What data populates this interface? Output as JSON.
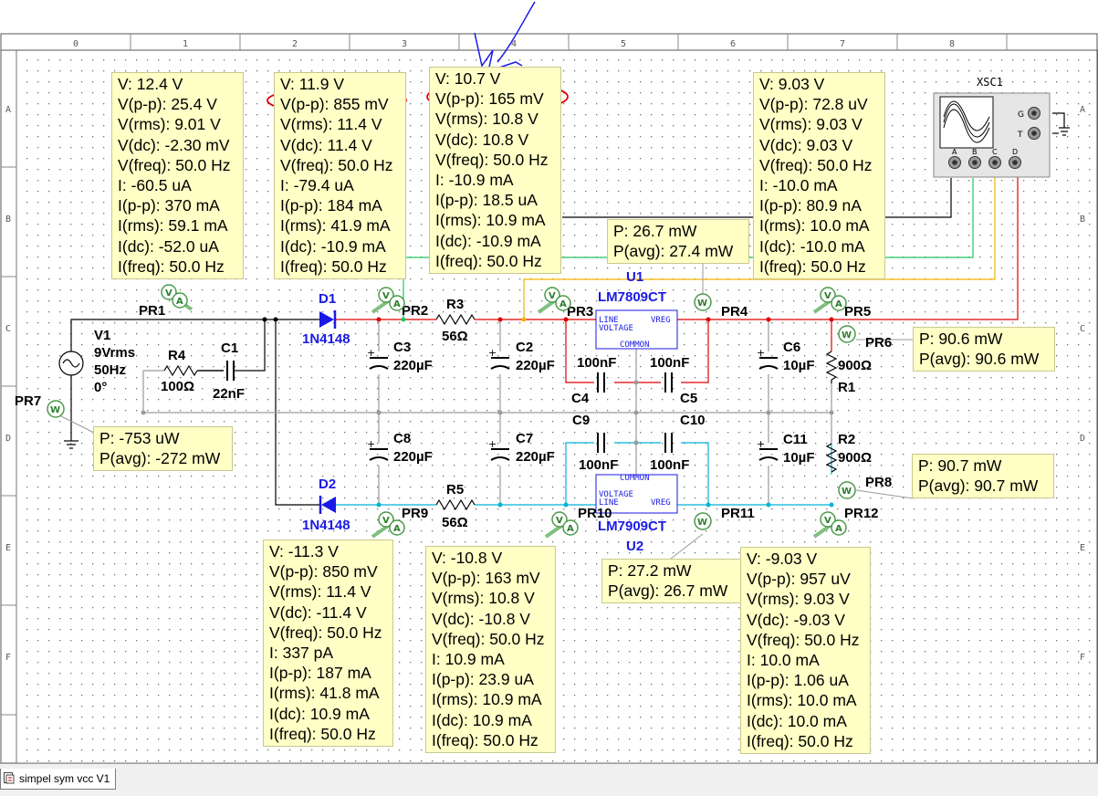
{
  "ruler": {
    "columns": [
      "0",
      "1",
      "2",
      "3",
      "4",
      "5",
      "6",
      "7",
      "8"
    ],
    "rows": [
      "A",
      "B",
      "C",
      "D",
      "E",
      "F"
    ]
  },
  "components": {
    "v1": {
      "name": "V1",
      "line1": "9Vrms",
      "line2": "50Hz",
      "line3": "0°"
    },
    "r4": {
      "name": "R4",
      "value": "100Ω"
    },
    "c1": {
      "name": "C1",
      "value": "22nF"
    },
    "d1": {
      "name": "D1",
      "model": "1N4148"
    },
    "d2": {
      "name": "D2",
      "model": "1N4148"
    },
    "r3": {
      "name": "R3",
      "value": "56Ω"
    },
    "r5": {
      "name": "R5",
      "value": "56Ω"
    },
    "c3": {
      "name": "C3",
      "value": "220µF"
    },
    "c2": {
      "name": "C2",
      "value": "220µF"
    },
    "c8": {
      "name": "C8",
      "value": "220µF"
    },
    "c7": {
      "name": "C7",
      "value": "220µF"
    },
    "c4": {
      "name": "C4",
      "value": "100nF"
    },
    "c5": {
      "name": "C5",
      "value": "100nF"
    },
    "c9": {
      "name": "C9",
      "value": "100nF"
    },
    "c10": {
      "name": "C10",
      "value": "100nF"
    },
    "c6": {
      "name": "C6",
      "value": "10µF"
    },
    "c11": {
      "name": "C11",
      "value": "10µF"
    },
    "r1": {
      "name": "R1",
      "value": "900Ω"
    },
    "r2": {
      "name": "R2",
      "value": "900Ω"
    },
    "u1": {
      "name": "U1",
      "model": "LM7809CT",
      "pin_line": "LINE",
      "pin_vreg": "VREG",
      "pin_voltage": "VOLTAGE",
      "pin_common": "COMMON"
    },
    "u2": {
      "name": "U2",
      "model": "LM7909CT",
      "pin_line": "LINE",
      "pin_vreg": "VREG",
      "pin_voltage": "VOLTAGE",
      "pin_common": "COMMON"
    },
    "xsc1": {
      "name": "XSC1",
      "ch_a": "A",
      "ch_b": "B",
      "ch_c": "C",
      "ch_d": "D",
      "gnd": "G",
      "trig": "T"
    }
  },
  "probes": {
    "pr1": "PR1",
    "pr2": "PR2",
    "pr3": "PR3",
    "pr4": "PR4",
    "pr5": "PR5",
    "pr6": "PR6",
    "pr7": "PR7",
    "pr8": "PR8",
    "pr9": "PR9",
    "pr10": "PR10",
    "pr11": "PR11",
    "pr12": "PR12"
  },
  "probe_glyph": {
    "volt": "V",
    "amp": "A",
    "watt": "W"
  },
  "meters": {
    "pr1": [
      "V: 12.4 V",
      "V(p-p): 25.4 V",
      "V(rms): 9.01 V",
      "V(dc): -2.30 mV",
      "V(freq): 50.0 Hz",
      "I: -60.5 uA",
      "I(p-p): 370 mA",
      "I(rms): 59.1 mA",
      "I(dc): -52.0 uA",
      "I(freq): 50.0 Hz"
    ],
    "pr2": [
      "V: 11.9 V",
      "V(p-p): 855 mV",
      "V(rms): 11.4 V",
      "V(dc): 11.4 V",
      "V(freq): 50.0 Hz",
      "I: -79.4 uA",
      "I(p-p): 184 mA",
      "I(rms): 41.9 mA",
      "I(dc): -10.9 mA",
      "I(freq): 50.0 Hz"
    ],
    "pr3": [
      "V: 10.7 V",
      "V(p-p): 165 mV",
      "V(rms): 10.8 V",
      "V(dc): 10.8 V",
      "V(freq): 50.0 Hz",
      "I: -10.9 mA",
      "I(p-p): 18.5 uA",
      "I(rms): 10.9 mA",
      "I(dc): -10.9 mA",
      "I(freq): 50.0 Hz"
    ],
    "pr5": [
      "V: 9.03 V",
      "V(p-p): 72.8 uV",
      "V(rms): 9.03 V",
      "V(dc): 9.03 V",
      "V(freq): 50.0 Hz",
      "I: -10.0 mA",
      "I(p-p): 80.9 nA",
      "I(rms): 10.0 mA",
      "I(dc): -10.0 mA",
      "I(freq): 50.0 Hz"
    ],
    "pr4": [
      "P: 26.7 mW",
      "P(avg): 27.4 mW"
    ],
    "pr6": [
      "P: 90.6 mW",
      "P(avg): 90.6 mW"
    ],
    "pr7": [
      "P: -753 uW",
      "P(avg): -272 mW"
    ],
    "pr8": [
      "P: 90.7 mW",
      "P(avg): 90.7 mW"
    ],
    "pr11": [
      "P: 27.2 mW",
      "P(avg): 26.7 mW"
    ],
    "pr9": [
      "V: -11.3 V",
      "V(p-p): 850 mV",
      "V(rms): 11.4 V",
      "V(dc): -11.4 V",
      "V(freq): 50.0 Hz",
      "I: 337 pA",
      "I(p-p): 187 mA",
      "I(rms): 41.8 mA",
      "I(dc): 10.9 mA",
      "I(freq): 50.0 Hz"
    ],
    "pr10": [
      "V: -10.8 V",
      "V(p-p): 163 mV",
      "V(rms): 10.8 V",
      "V(dc): -10.8 V",
      "V(freq): 50.0 Hz",
      "I: 10.9 mA",
      "I(p-p): 23.9 uA",
      "I(rms): 10.9 mA",
      "I(dc): 10.9 mA",
      "I(freq): 50.0 Hz"
    ],
    "pr12": [
      "V: -9.03 V",
      "V(p-p): 957 uV",
      "V(rms): 9.03 V",
      "V(dc): -9.03 V",
      "V(freq): 50.0 Hz",
      "I: 10.0 mA",
      "I(p-p): 1.06 uA",
      "I(rms): 10.0 mA",
      "I(dc): 10.0 mA",
      "I(freq): 50.0 Hz"
    ]
  },
  "wire_colors": {
    "default": "#000000",
    "positive_rail": "#e00000",
    "negative_rail": "#00b4d8",
    "green": "#22c55e",
    "orange": "#f4b400",
    "gray": "#9a9a9a",
    "component_blue": "#1a1ae6"
  },
  "annotation_color": "#e00000",
  "tab": {
    "label": "simpel sym vcc V1",
    "icon": "schematic-icon"
  }
}
